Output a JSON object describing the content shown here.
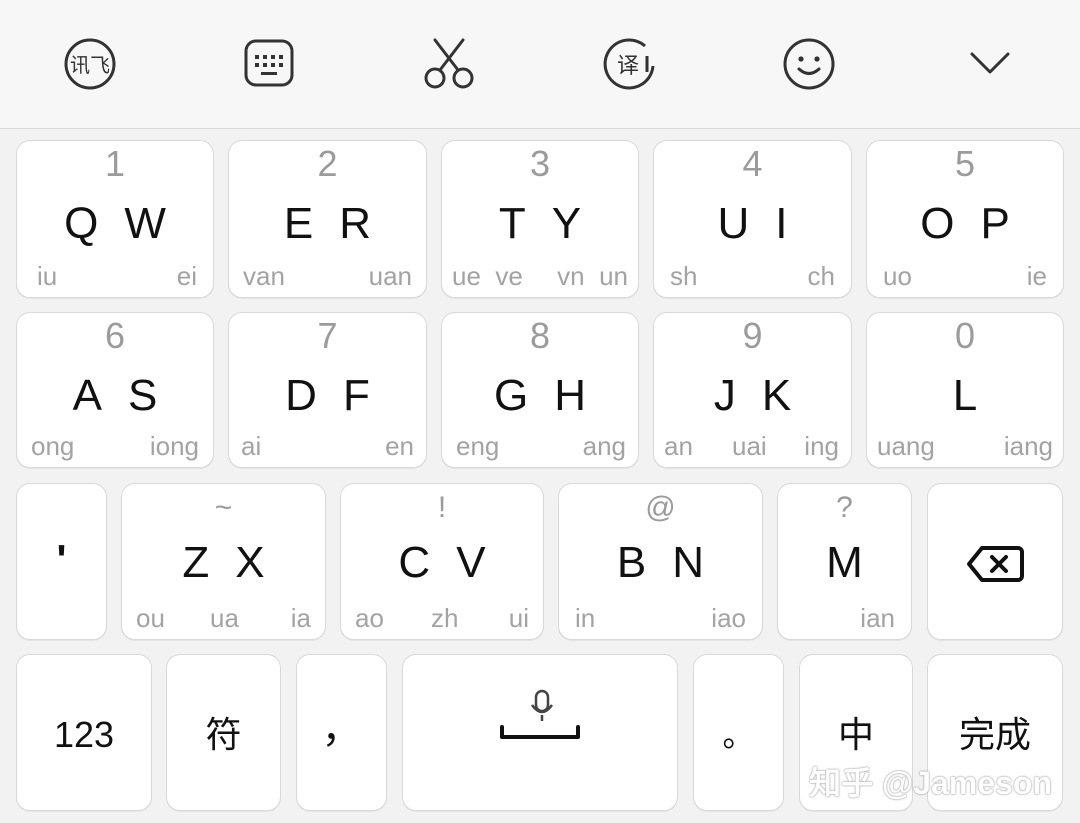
{
  "toolbar": {
    "icons": [
      "xunfei-logo-icon",
      "keyboard-icon",
      "scissors-icon",
      "translate-icon",
      "emoji-icon",
      "chevron-down-icon"
    ],
    "logo_text": "讯飞",
    "translate_text": "译"
  },
  "row1": [
    {
      "num": "1",
      "l1": "Q",
      "l2": "W",
      "pl": "iu",
      "pr": "ei"
    },
    {
      "num": "2",
      "l1": "E",
      "l2": "R",
      "pl": "van",
      "pr": "uan"
    },
    {
      "num": "3",
      "l1": "T",
      "l2": "Y",
      "pl": "ue  ve",
      "pr": "vn  un"
    },
    {
      "num": "4",
      "l1": "U",
      "l2": "I",
      "pl": "sh",
      "pr": "ch"
    },
    {
      "num": "5",
      "l1": "O",
      "l2": "P",
      "pl": "uo",
      "pr": "ie"
    }
  ],
  "row2": [
    {
      "num": "6",
      "l1": "A",
      "l2": "S",
      "pl": "ong",
      "pr": "iong"
    },
    {
      "num": "7",
      "l1": "D",
      "l2": "F",
      "pl": "ai",
      "pr": "en"
    },
    {
      "num": "8",
      "l1": "G",
      "l2": "H",
      "pl": "eng",
      "pr": "ang"
    },
    {
      "num": "9",
      "l1": "J",
      "l2": "K",
      "pl": "an",
      "pm": "uai",
      "pr": "ing"
    },
    {
      "num": "0",
      "l1": "L",
      "l2": "",
      "pl": "uang",
      "pr": "iang"
    }
  ],
  "row3": {
    "apostrophe": "'",
    "keys": [
      {
        "sym": "~",
        "l1": "Z",
        "l2": "X",
        "pl": "ou",
        "pm": "ua",
        "pr": "ia"
      },
      {
        "sym": "!",
        "l1": "C",
        "l2": "V",
        "pl": "ao",
        "pm": "zh",
        "pr": "ui"
      },
      {
        "sym": "@",
        "l1": "B",
        "l2": "N",
        "pl": "in",
        "pr": "iao"
      },
      {
        "sym": "?",
        "l1": "M",
        "l2": "",
        "pl": "",
        "pr": "ian"
      }
    ]
  },
  "row4": {
    "num_label": "123",
    "sym_label": "符",
    "comma": "，",
    "period": "。",
    "lang": "中",
    "done": "完成"
  },
  "watermark": "知乎 @Jameson",
  "colors": {
    "key_bg": "#ffffff",
    "board_bg": "#f2f2f2",
    "hint": "#9b9b9b",
    "text": "#111111"
  }
}
